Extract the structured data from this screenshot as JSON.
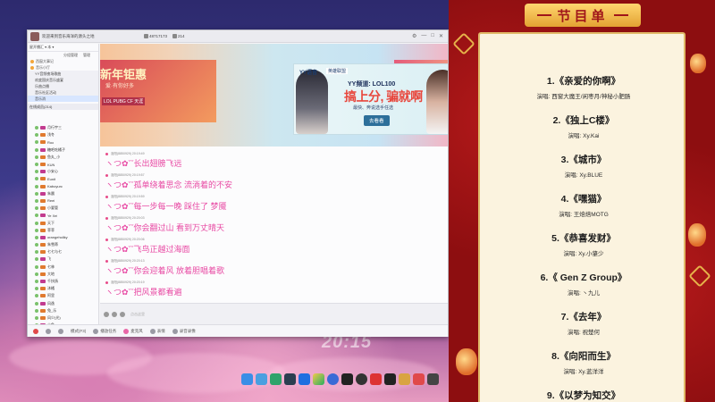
{
  "window": {
    "title": "欢迎来到音乐海洋的源头之地",
    "channel_id": "48717173",
    "online_count": "214"
  },
  "sidebar": {
    "top_label": "星开播汇 ▾  本 ▾",
    "tabs": [
      "分组管理",
      "管理"
    ],
    "items": [
      {
        "label": "西窗大事记"
      },
      {
        "label": "音乐小厅"
      }
    ],
    "subitems": [
      {
        "label": "YY音频夜场歌曲"
      },
      {
        "label": "欢度国庆音乐盛宴"
      },
      {
        "label": "乐曲点播"
      },
      {
        "label": "音乐社区活动"
      },
      {
        "label": "音乐消"
      }
    ],
    "member_header": "在线成员(214)",
    "members": [
      "月行宇三",
      "浅冬",
      "Roo",
      "糖吧吃橘子",
      "鱼丸_小",
      "KUN",
      "小安心",
      "Eunit",
      "Kaboyurc",
      "朱晨",
      "Reei",
      "小要管",
      "Ye Xei",
      "天下",
      "菲菲",
      "orangeholiky",
      "朱雪蒂",
      "七七与七",
      "飞",
      "七林",
      "大地",
      "千扶扬",
      "沐橘",
      "阿里",
      "风逸",
      "兔_乐",
      "风少(光)",
      "小鱼",
      "北北",
      "别说",
      "情深",
      "小公",
      "发光",
      "小贝",
      "风",
      "月"
    ]
  },
  "banner": {
    "left_title": "新年钜惠",
    "left_subtitle": "爱·有你好多",
    "left_tag": "LOL PUBG CF 天涯",
    "ad_brand": "YY语音",
    "ad_brand2": "英雄联盟",
    "ad_channel": "YY频道: LOL100",
    "ad_main": "搞上分, 骗就啊",
    "ad_desc": "最快、奔说选手任选",
    "ad_button": "去看看"
  },
  "chat": {
    "messages": [
      {
        "meta": "逝阳(8850929) 20:19:49",
        "text": "ヽつ✿ˇˇ长出翅膀飞远"
      },
      {
        "meta": "逝阳(8850929) 20:19:57",
        "text": "ヽつ✿ˇˇ孤单绕着思念 流淌着的不安"
      },
      {
        "meta": "逝阳(8850929) 20:19:59",
        "text": "ヽつ✿ˇˇ每一步每一晚 踩住了 梦魇"
      },
      {
        "meta": "逝阳(8850929) 20:20:03",
        "text": "ヽつ✿ˇˇ你会翻过山 看到万丈晴天"
      },
      {
        "meta": "逝阳(8850929) 20:20:06",
        "text": "ヽつ✿ˇˇ飞鸟正越过海面"
      },
      {
        "meta": "逝阳(8850929) 20:20:13",
        "text": "ヽつ✿ˇˇ你会迎着风 放着胆唱着歌"
      },
      {
        "meta": "逝阳(8850929) 20:20:19",
        "text": "ヽつ✿ˇˇ把风景都看遍"
      }
    ],
    "input_placeholder": "点击这里"
  },
  "bottom_bar": {
    "items": [
      "模式(F3)",
      "播放任务",
      "麦克风",
      "表情",
      "录音录像"
    ]
  },
  "desktop": {
    "clock": "20:15"
  },
  "program": {
    "header": "节目单",
    "items": [
      {
        "title": "1.《亲爱的你啊》",
        "perf": "演唱: 西窗大魔王/闲枣月/神秘小肥肠"
      },
      {
        "title": "2.《独上C楼》",
        "perf": "演唱: Xy.Kai"
      },
      {
        "title": "3.《城市》",
        "perf": "演唱: Xy.BLUE"
      },
      {
        "title": "4.《嘿猫》",
        "perf": "演唱: 王焙焙MOTG"
      },
      {
        "title": "5.《恭喜发财》",
        "perf": "演唱: Xy.小肇少"
      },
      {
        "title": "6.《 Gen Z Group》",
        "perf": "演唱: 丶九儿"
      },
      {
        "title": "7.《去年》",
        "perf": "演唱: 祝楚何"
      },
      {
        "title": "8.《向阳而生》",
        "perf": "演唱: Xy.蓝洋洋"
      },
      {
        "title": "9.《以梦为知交》",
        "perf": ""
      }
    ]
  }
}
